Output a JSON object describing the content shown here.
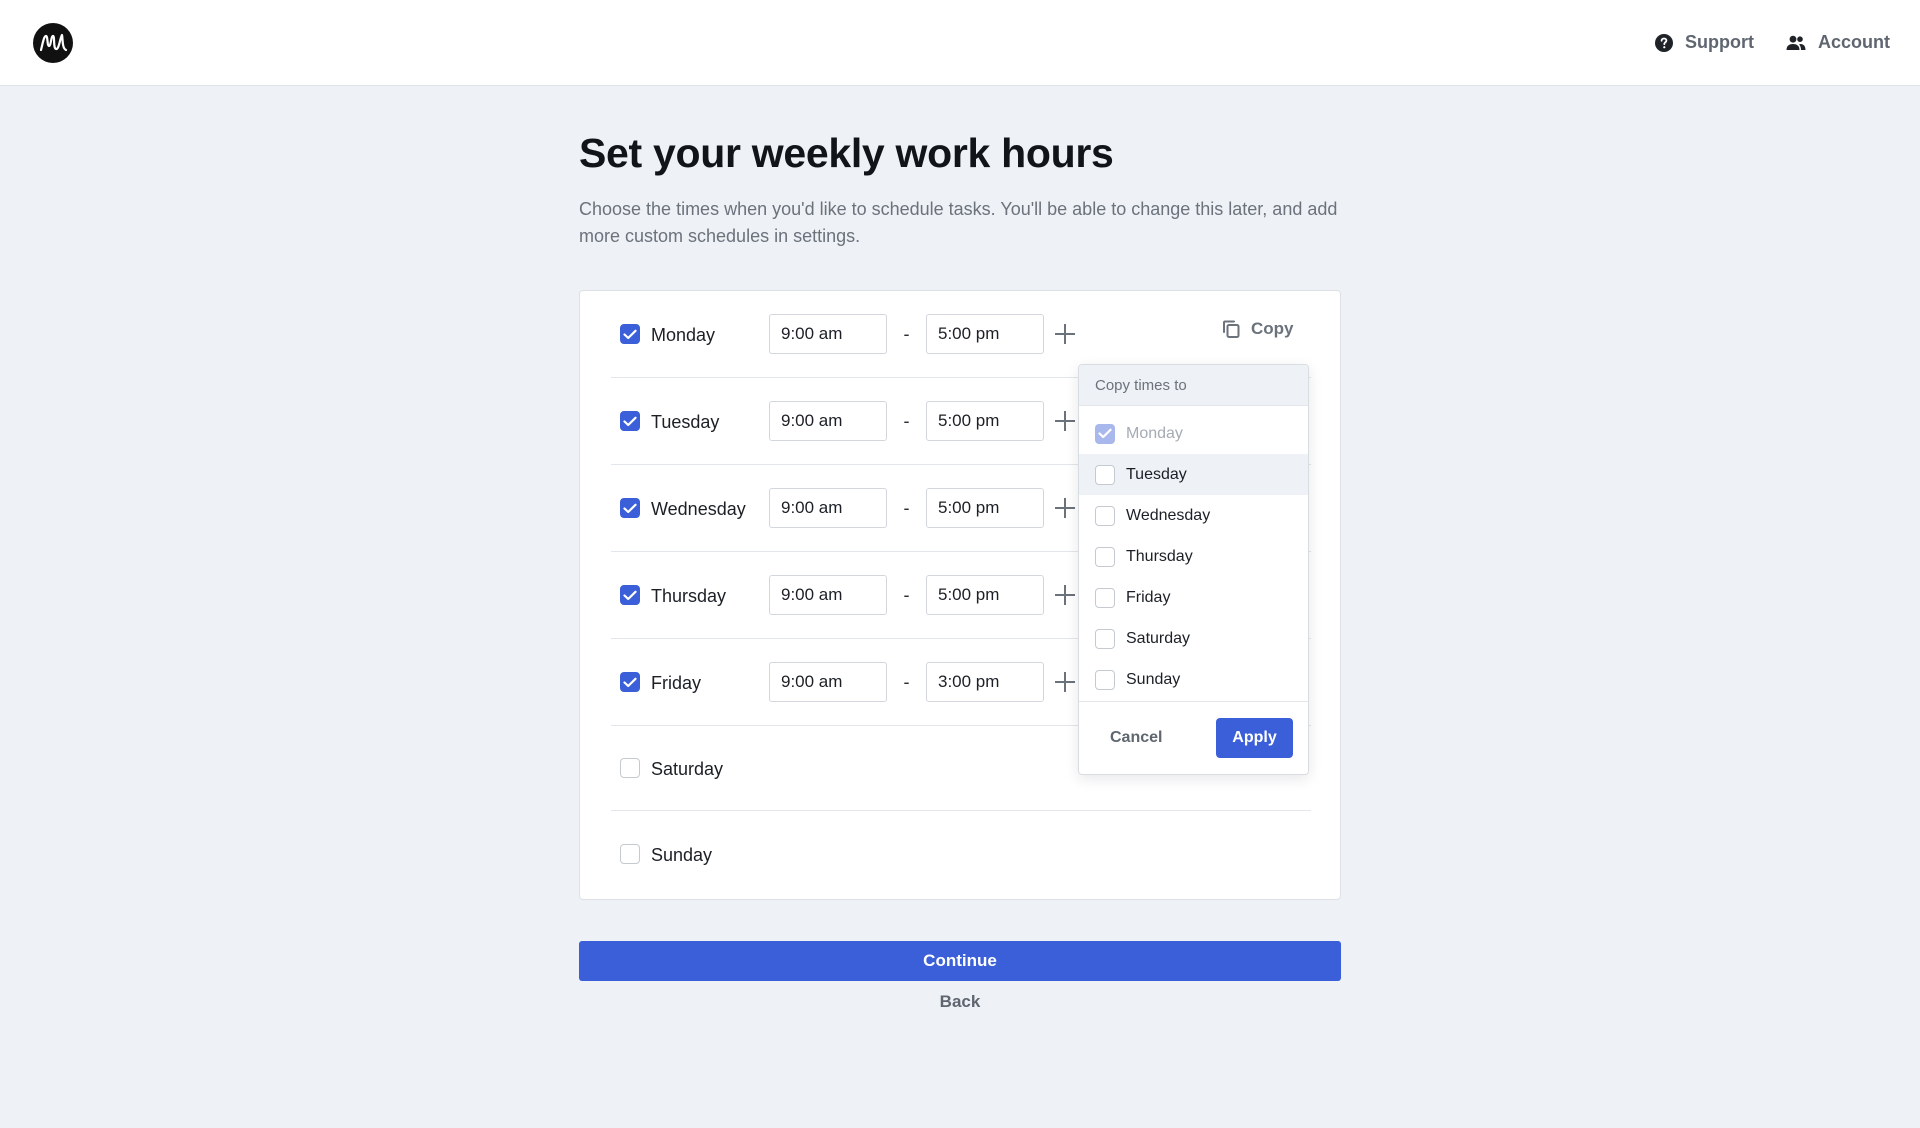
{
  "header": {
    "logo_icon": "app-logo",
    "nav": [
      {
        "label": "Support",
        "icon": "help-circle-icon"
      },
      {
        "label": "Account",
        "icon": "users-icon"
      }
    ]
  },
  "page": {
    "title": "Set your weekly work hours",
    "subtitle": "Choose the times when you'd like to schedule tasks. You'll be able to change this later, and add more custom schedules in settings."
  },
  "schedule": {
    "copy_label": "Copy",
    "days": [
      {
        "name": "Monday",
        "checked": true,
        "start": "9:00 am",
        "end": "5:00 pm"
      },
      {
        "name": "Tuesday",
        "checked": true,
        "start": "9:00 am",
        "end": "5:00 pm"
      },
      {
        "name": "Wednesday",
        "checked": true,
        "start": "9:00 am",
        "end": "5:00 pm"
      },
      {
        "name": "Thursday",
        "checked": true,
        "start": "9:00 am",
        "end": "5:00 pm"
      },
      {
        "name": "Friday",
        "checked": true,
        "start": "9:00 am",
        "end": "3:00 pm"
      },
      {
        "name": "Saturday",
        "checked": false
      },
      {
        "name": "Sunday",
        "checked": false
      }
    ],
    "separator": "-"
  },
  "copy_popover": {
    "heading": "Copy times to",
    "options": [
      {
        "label": "Monday",
        "checked": true,
        "disabled": true
      },
      {
        "label": "Tuesday",
        "checked": false,
        "hovered": true
      },
      {
        "label": "Wednesday",
        "checked": false
      },
      {
        "label": "Thursday",
        "checked": false
      },
      {
        "label": "Friday",
        "checked": false
      },
      {
        "label": "Saturday",
        "checked": false
      },
      {
        "label": "Sunday",
        "checked": false
      }
    ],
    "cancel_label": "Cancel",
    "apply_label": "Apply"
  },
  "actions": {
    "continue_label": "Continue",
    "back_label": "Back"
  },
  "colors": {
    "accent": "#3b5fd9",
    "background": "#eef1f5"
  }
}
